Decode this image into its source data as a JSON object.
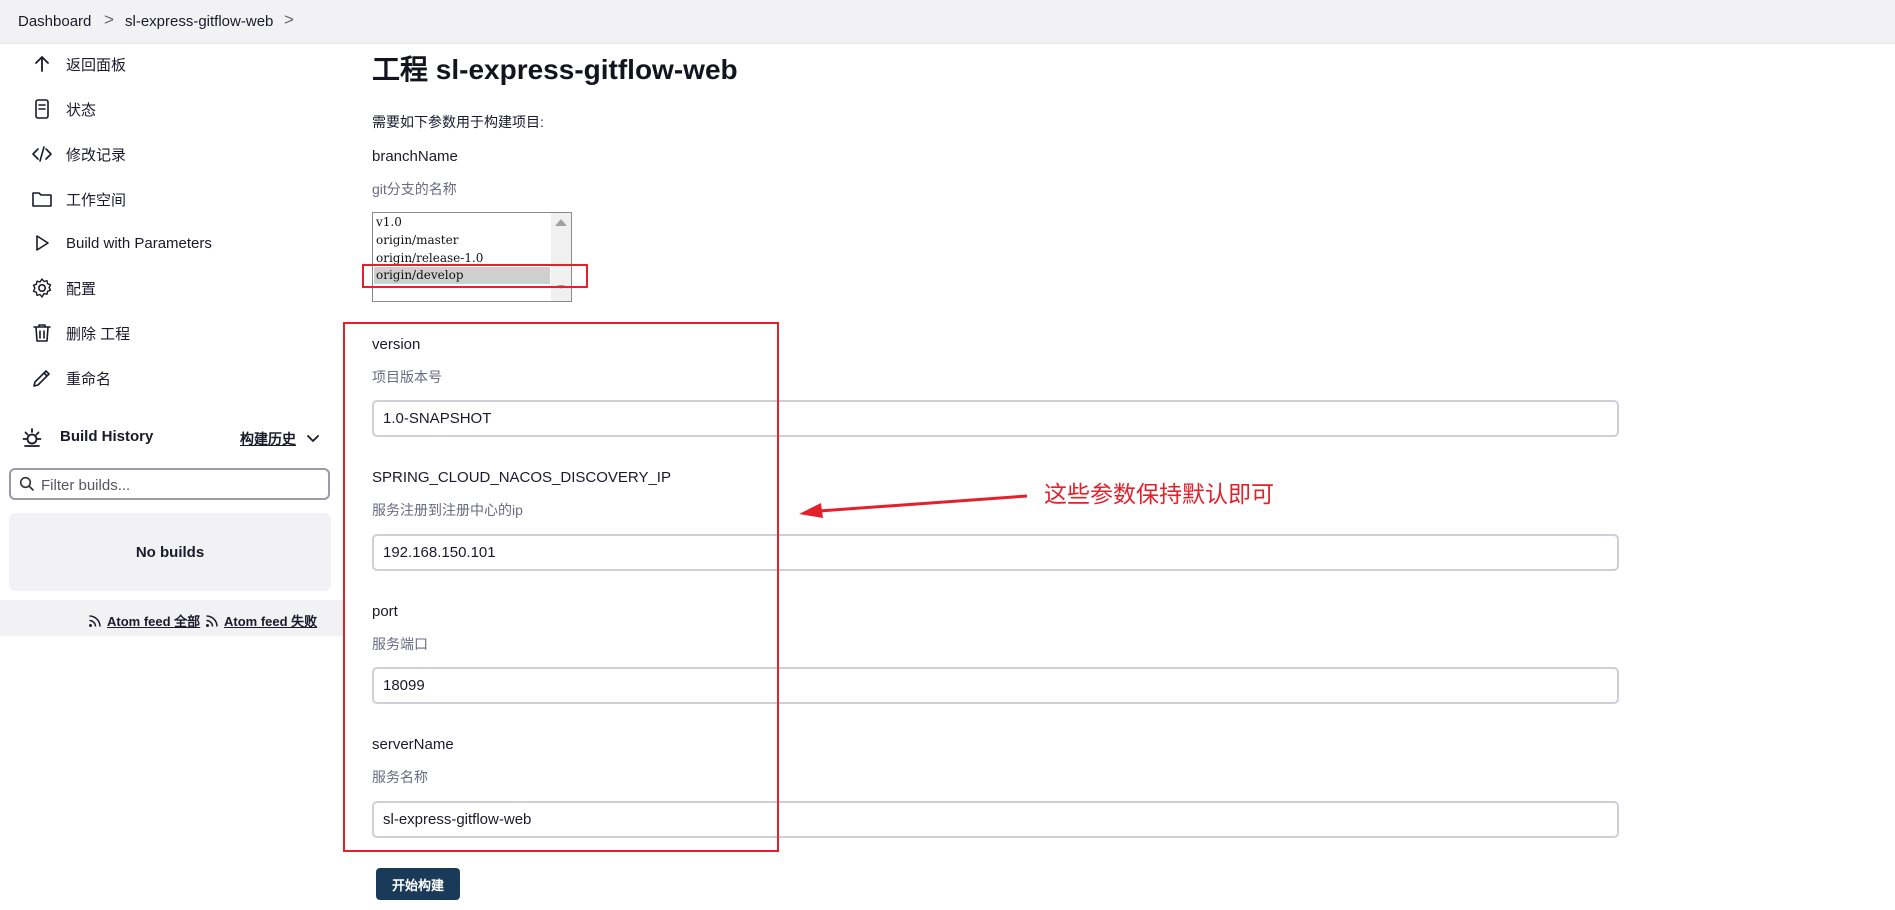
{
  "breadcrumb": {
    "items": [
      "Dashboard",
      "sl-express-gitflow-web"
    ],
    "separator": ">"
  },
  "sidebar": {
    "items": [
      {
        "label": "返回面板",
        "icon": "arrow-up-icon"
      },
      {
        "label": "状态",
        "icon": "document-icon"
      },
      {
        "label": "修改记录",
        "icon": "code-icon"
      },
      {
        "label": "工作空间",
        "icon": "folder-icon"
      },
      {
        "label": "Build with Parameters",
        "icon": "play-icon"
      },
      {
        "label": "配置",
        "icon": "gear-icon"
      },
      {
        "label": "删除 工程",
        "icon": "trash-icon"
      },
      {
        "label": "重命名",
        "icon": "pencil-icon"
      }
    ]
  },
  "build_history": {
    "title": "Build History",
    "trend_label": "构建历史",
    "filter_placeholder": "Filter builds...",
    "empty_text": "No builds",
    "feed_all": "Atom feed 全部",
    "feed_failed": "Atom feed 失败"
  },
  "main": {
    "title": "工程 sl-express-gitflow-web",
    "intro": "需要如下参数用于构建项目:",
    "branch": {
      "name": "branchName",
      "description": "git分支的名称",
      "options": [
        "v1.0",
        "origin/master",
        "origin/release-1.0",
        "origin/develop"
      ],
      "selected": "origin/develop"
    },
    "params": [
      {
        "name": "version",
        "description": "项目版本号",
        "value": "1.0-SNAPSHOT"
      },
      {
        "name": "SPRING_CLOUD_NACOS_DISCOVERY_IP",
        "description": "服务注册到注册中心的ip",
        "value": "192.168.150.101"
      },
      {
        "name": "port",
        "description": "服务端口",
        "value": "18099"
      },
      {
        "name": "serverName",
        "description": "服务名称",
        "value": "sl-express-gitflow-web"
      }
    ],
    "build_button": "开始构建"
  },
  "annotation": {
    "text": "这些参数保持默认即可",
    "color": "#e4202a"
  },
  "colors": {
    "accent_red": "#e4202a",
    "button_bg": "#1a3a5a",
    "sidebar_bg": "#f2f2f5"
  }
}
